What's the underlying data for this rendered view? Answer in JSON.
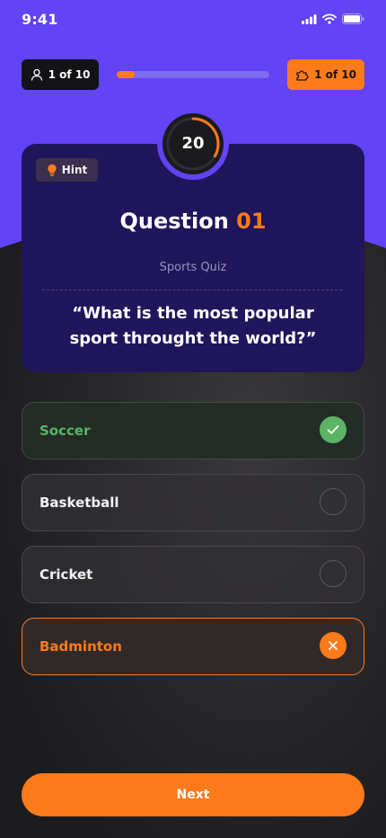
{
  "status_bar": {
    "time": "9:41"
  },
  "top": {
    "players_label": "1 of 10",
    "progress_fraction": 0.12,
    "score_label": "1 of 10"
  },
  "timer": {
    "value": "20",
    "fraction": 0.33
  },
  "card": {
    "hint_label": "Hint",
    "title_prefix": "Question",
    "title_number": "01",
    "category": "Sports Quiz",
    "question": "“What is the most popular sport throught the world?”"
  },
  "options": [
    {
      "label": "Soccer",
      "state": "correct"
    },
    {
      "label": "Basketball",
      "state": "unselected"
    },
    {
      "label": "Cricket",
      "state": "unselected"
    },
    {
      "label": "Badminton",
      "state": "wrong"
    }
  ],
  "next_label": "Next",
  "colors": {
    "accent": "#ff7a1a",
    "purple": "#6243f5",
    "card": "#1f165c",
    "success": "#5bb366",
    "background": "#232225"
  },
  "icons": {
    "players": "user-icon",
    "score": "puzzle-icon",
    "hint": "lightbulb-icon",
    "correct": "check-icon",
    "wrong": "close-icon"
  }
}
